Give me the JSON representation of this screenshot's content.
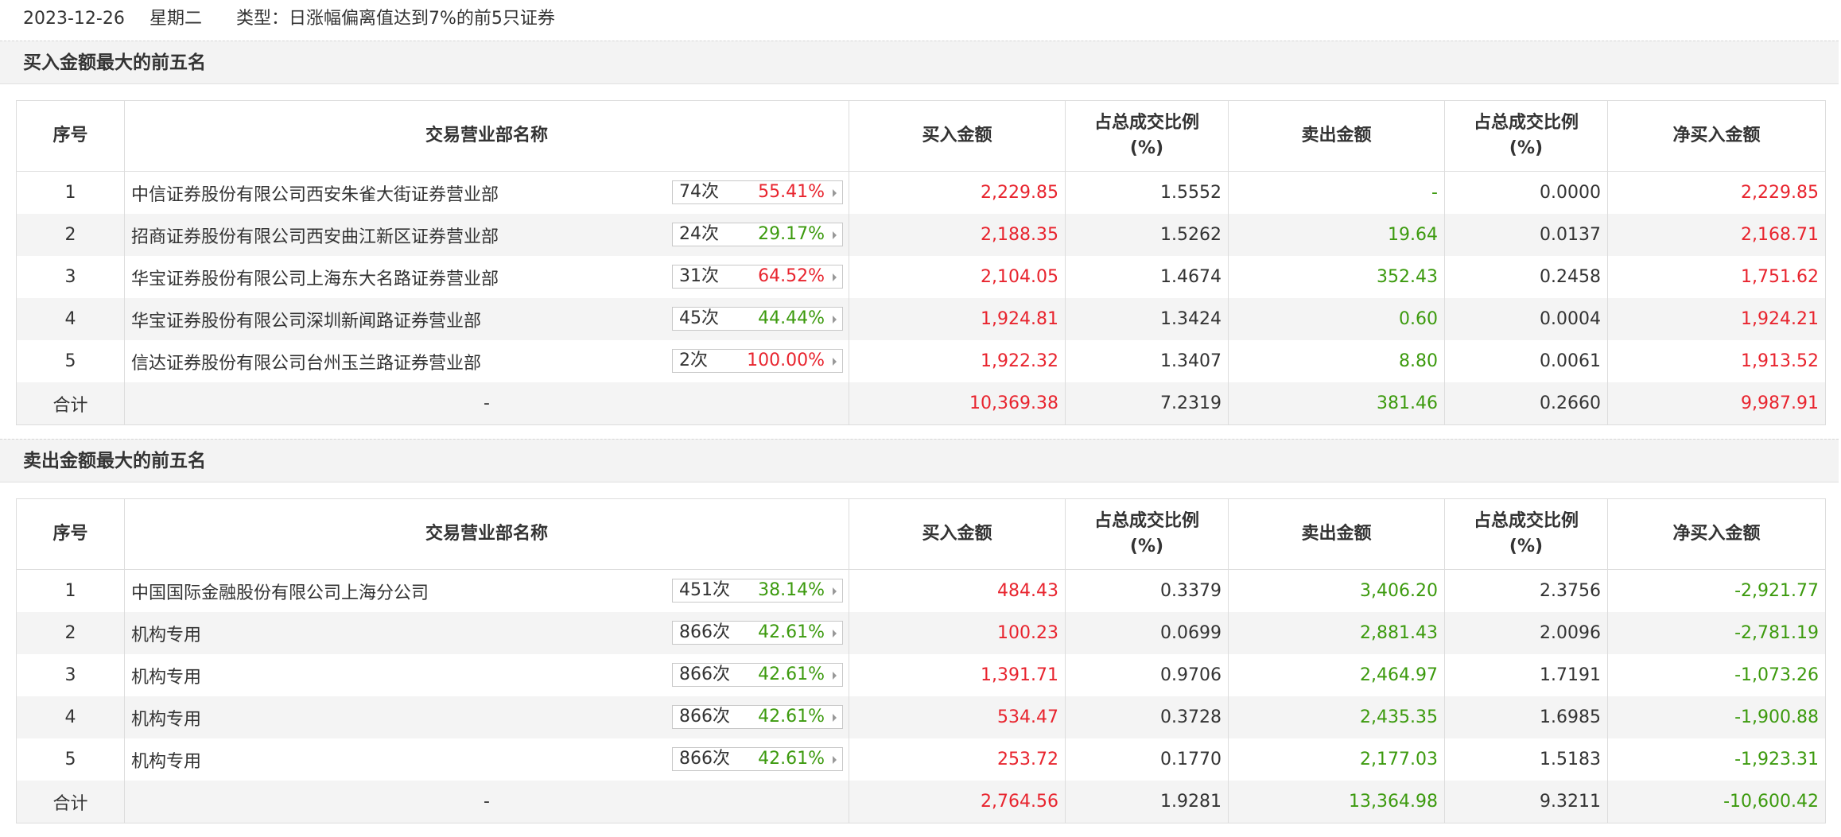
{
  "header": {
    "date": "2023-12-26",
    "weekday": "星期二",
    "type_text": "类型：日涨幅偏离值达到7%的前5只证券"
  },
  "columns": [
    "序号",
    "交易营业部名称",
    "买入金额",
    "占总成交比例\n(%)",
    "卖出金额",
    "占总成交比例\n(%)",
    "净买入金额"
  ],
  "colors": {
    "red": "#e8242e",
    "green": "#3c9a0e"
  },
  "icons": [
    "caret-right-icon"
  ],
  "sections": [
    {
      "title": "买入金额最大的前五名",
      "rows": [
        {
          "idx": "1",
          "name": "中信证券股份有限公司西安朱雀大街证券营业部",
          "count": "74次",
          "rate": "55.41%",
          "rate_color": "red",
          "buy": "2,229.85",
          "buy_pct": "1.5552",
          "sell": "-",
          "sell_pct": "0.0000",
          "net": "2,229.85",
          "net_color": "red"
        },
        {
          "idx": "2",
          "name": "招商证券股份有限公司西安曲江新区证券营业部",
          "count": "24次",
          "rate": "29.17%",
          "rate_color": "green",
          "buy": "2,188.35",
          "buy_pct": "1.5262",
          "sell": "19.64",
          "sell_pct": "0.0137",
          "net": "2,168.71",
          "net_color": "red"
        },
        {
          "idx": "3",
          "name": "华宝证券股份有限公司上海东大名路证券营业部",
          "count": "31次",
          "rate": "64.52%",
          "rate_color": "red",
          "buy": "2,104.05",
          "buy_pct": "1.4674",
          "sell": "352.43",
          "sell_pct": "0.2458",
          "net": "1,751.62",
          "net_color": "red"
        },
        {
          "idx": "4",
          "name": "华宝证券股份有限公司深圳新闻路证券营业部",
          "count": "45次",
          "rate": "44.44%",
          "rate_color": "green",
          "buy": "1,924.81",
          "buy_pct": "1.3424",
          "sell": "0.60",
          "sell_pct": "0.0004",
          "net": "1,924.21",
          "net_color": "red"
        },
        {
          "idx": "5",
          "name": "信达证券股份有限公司台州玉兰路证券营业部",
          "count": "2次",
          "rate": "100.00%",
          "rate_color": "red",
          "buy": "1,922.32",
          "buy_pct": "1.3407",
          "sell": "8.80",
          "sell_pct": "0.0061",
          "net": "1,913.52",
          "net_color": "red"
        }
      ],
      "total": {
        "label": "合计",
        "name": "-",
        "buy": "10,369.38",
        "buy_pct": "7.2319",
        "sell": "381.46",
        "sell_pct": "0.2660",
        "net": "9,987.91",
        "net_color": "red"
      }
    },
    {
      "title": "卖出金额最大的前五名",
      "rows": [
        {
          "idx": "1",
          "name": "中国国际金融股份有限公司上海分公司",
          "count": "451次",
          "rate": "38.14%",
          "rate_color": "green",
          "buy": "484.43",
          "buy_pct": "0.3379",
          "sell": "3,406.20",
          "sell_pct": "2.3756",
          "net": "-2,921.77",
          "net_color": "green"
        },
        {
          "idx": "2",
          "name": "机构专用",
          "count": "866次",
          "rate": "42.61%",
          "rate_color": "green",
          "buy": "100.23",
          "buy_pct": "0.0699",
          "sell": "2,881.43",
          "sell_pct": "2.0096",
          "net": "-2,781.19",
          "net_color": "green"
        },
        {
          "idx": "3",
          "name": "机构专用",
          "count": "866次",
          "rate": "42.61%",
          "rate_color": "green",
          "buy": "1,391.71",
          "buy_pct": "0.9706",
          "sell": "2,464.97",
          "sell_pct": "1.7191",
          "net": "-1,073.26",
          "net_color": "green"
        },
        {
          "idx": "4",
          "name": "机构专用",
          "count": "866次",
          "rate": "42.61%",
          "rate_color": "green",
          "buy": "534.47",
          "buy_pct": "0.3728",
          "sell": "2,435.35",
          "sell_pct": "1.6985",
          "net": "-1,900.88",
          "net_color": "green"
        },
        {
          "idx": "5",
          "name": "机构专用",
          "count": "866次",
          "rate": "42.61%",
          "rate_color": "green",
          "buy": "253.72",
          "buy_pct": "0.1770",
          "sell": "2,177.03",
          "sell_pct": "1.5183",
          "net": "-1,923.31",
          "net_color": "green"
        }
      ],
      "total": {
        "label": "合计",
        "name": "-",
        "buy": "2,764.56",
        "buy_pct": "1.9281",
        "sell": "13,364.98",
        "sell_pct": "9.3211",
        "net": "-10,600.42",
        "net_color": "green"
      }
    }
  ]
}
